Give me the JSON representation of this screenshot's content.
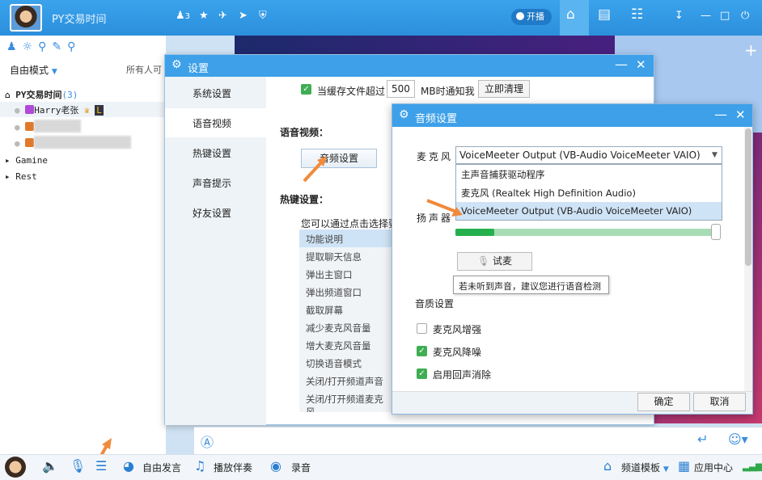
{
  "app": {
    "title": "PY交易时间",
    "online_count": "3",
    "live_button": "开播"
  },
  "left": {
    "mode": "自由模式",
    "all_people": "所有人可",
    "channel_root": "PY交易时间",
    "channel_count": "(3)",
    "user1": "Harry老张",
    "medal_letter": "L",
    "sub1": "Gamine",
    "sub2": "Rest"
  },
  "settings": {
    "title": "设置",
    "nav": [
      "系统设置",
      "语音视频",
      "热键设置",
      "声音提示",
      "好友设置"
    ],
    "cache_label": "当缓存文件超过",
    "cache_value": "500",
    "cache_unit": "MB时通知我",
    "clear_button": "立即清理",
    "voice_section": "语音视频：",
    "audio_button": "音频设置",
    "hotkey_section": "热键设置：",
    "hotkey_desc": "您可以通过点击选择要",
    "hotkeys": [
      "功能说明",
      "提取聊天信息",
      "弹出主窗口",
      "弹出频道窗口",
      "截取屏幕",
      "减少麦克风音量",
      "增大麦克风音量",
      "切换语音模式",
      "关闭/打开频道声音",
      "关闭/打开频道麦克风"
    ]
  },
  "audio": {
    "title": "音频设置",
    "mic_label": "麦克风",
    "mic_selected": "VoiceMeeter Output (VB-Audio VoiceMeeter VAIO)",
    "mic_options": [
      "主声音捕获驱动程序",
      "麦克风 (Realtek High Definition Audio)",
      "VoiceMeeter Output (VB-Audio VoiceMeeter VAIO)"
    ],
    "speaker_label": "扬声器",
    "volume_level": 0.15,
    "try_button": "试麦",
    "tooltip": "若未听到声音，建议您进行语音检测",
    "quality_label": "音质设置",
    "options": [
      {
        "label": "麦克风增强",
        "checked": false
      },
      {
        "label": "麦克风降噪",
        "checked": true
      },
      {
        "label": "启用回声消除",
        "checked": true
      }
    ],
    "ok": "确定",
    "cancel": "取消"
  },
  "bottom": {
    "free_speak": "自由发言",
    "play_music": "播放伴奏",
    "record": "录音",
    "channel_template": "频道模板",
    "app_center": "应用中心"
  },
  "colors": {
    "accent": "#3da0e8",
    "check": "#3fae53",
    "arrow": "#f08a3c"
  }
}
